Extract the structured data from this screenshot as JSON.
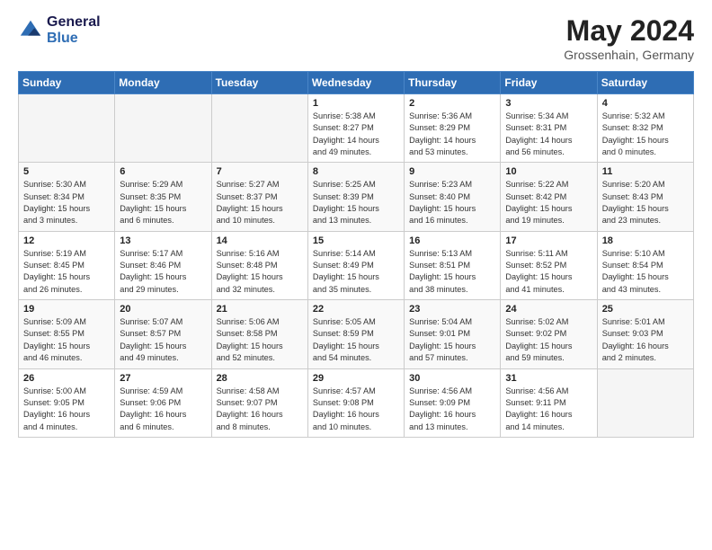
{
  "header": {
    "logo_line1": "General",
    "logo_line2": "Blue",
    "month": "May 2024",
    "location": "Grossenhain, Germany"
  },
  "weekdays": [
    "Sunday",
    "Monday",
    "Tuesday",
    "Wednesday",
    "Thursday",
    "Friday",
    "Saturday"
  ],
  "weeks": [
    [
      {
        "day": "",
        "info": ""
      },
      {
        "day": "",
        "info": ""
      },
      {
        "day": "",
        "info": ""
      },
      {
        "day": "1",
        "info": "Sunrise: 5:38 AM\nSunset: 8:27 PM\nDaylight: 14 hours\nand 49 minutes."
      },
      {
        "day": "2",
        "info": "Sunrise: 5:36 AM\nSunset: 8:29 PM\nDaylight: 14 hours\nand 53 minutes."
      },
      {
        "day": "3",
        "info": "Sunrise: 5:34 AM\nSunset: 8:31 PM\nDaylight: 14 hours\nand 56 minutes."
      },
      {
        "day": "4",
        "info": "Sunrise: 5:32 AM\nSunset: 8:32 PM\nDaylight: 15 hours\nand 0 minutes."
      }
    ],
    [
      {
        "day": "5",
        "info": "Sunrise: 5:30 AM\nSunset: 8:34 PM\nDaylight: 15 hours\nand 3 minutes."
      },
      {
        "day": "6",
        "info": "Sunrise: 5:29 AM\nSunset: 8:35 PM\nDaylight: 15 hours\nand 6 minutes."
      },
      {
        "day": "7",
        "info": "Sunrise: 5:27 AM\nSunset: 8:37 PM\nDaylight: 15 hours\nand 10 minutes."
      },
      {
        "day": "8",
        "info": "Sunrise: 5:25 AM\nSunset: 8:39 PM\nDaylight: 15 hours\nand 13 minutes."
      },
      {
        "day": "9",
        "info": "Sunrise: 5:23 AM\nSunset: 8:40 PM\nDaylight: 15 hours\nand 16 minutes."
      },
      {
        "day": "10",
        "info": "Sunrise: 5:22 AM\nSunset: 8:42 PM\nDaylight: 15 hours\nand 19 minutes."
      },
      {
        "day": "11",
        "info": "Sunrise: 5:20 AM\nSunset: 8:43 PM\nDaylight: 15 hours\nand 23 minutes."
      }
    ],
    [
      {
        "day": "12",
        "info": "Sunrise: 5:19 AM\nSunset: 8:45 PM\nDaylight: 15 hours\nand 26 minutes."
      },
      {
        "day": "13",
        "info": "Sunrise: 5:17 AM\nSunset: 8:46 PM\nDaylight: 15 hours\nand 29 minutes."
      },
      {
        "day": "14",
        "info": "Sunrise: 5:16 AM\nSunset: 8:48 PM\nDaylight: 15 hours\nand 32 minutes."
      },
      {
        "day": "15",
        "info": "Sunrise: 5:14 AM\nSunset: 8:49 PM\nDaylight: 15 hours\nand 35 minutes."
      },
      {
        "day": "16",
        "info": "Sunrise: 5:13 AM\nSunset: 8:51 PM\nDaylight: 15 hours\nand 38 minutes."
      },
      {
        "day": "17",
        "info": "Sunrise: 5:11 AM\nSunset: 8:52 PM\nDaylight: 15 hours\nand 41 minutes."
      },
      {
        "day": "18",
        "info": "Sunrise: 5:10 AM\nSunset: 8:54 PM\nDaylight: 15 hours\nand 43 minutes."
      }
    ],
    [
      {
        "day": "19",
        "info": "Sunrise: 5:09 AM\nSunset: 8:55 PM\nDaylight: 15 hours\nand 46 minutes."
      },
      {
        "day": "20",
        "info": "Sunrise: 5:07 AM\nSunset: 8:57 PM\nDaylight: 15 hours\nand 49 minutes."
      },
      {
        "day": "21",
        "info": "Sunrise: 5:06 AM\nSunset: 8:58 PM\nDaylight: 15 hours\nand 52 minutes."
      },
      {
        "day": "22",
        "info": "Sunrise: 5:05 AM\nSunset: 8:59 PM\nDaylight: 15 hours\nand 54 minutes."
      },
      {
        "day": "23",
        "info": "Sunrise: 5:04 AM\nSunset: 9:01 PM\nDaylight: 15 hours\nand 57 minutes."
      },
      {
        "day": "24",
        "info": "Sunrise: 5:02 AM\nSunset: 9:02 PM\nDaylight: 15 hours\nand 59 minutes."
      },
      {
        "day": "25",
        "info": "Sunrise: 5:01 AM\nSunset: 9:03 PM\nDaylight: 16 hours\nand 2 minutes."
      }
    ],
    [
      {
        "day": "26",
        "info": "Sunrise: 5:00 AM\nSunset: 9:05 PM\nDaylight: 16 hours\nand 4 minutes."
      },
      {
        "day": "27",
        "info": "Sunrise: 4:59 AM\nSunset: 9:06 PM\nDaylight: 16 hours\nand 6 minutes."
      },
      {
        "day": "28",
        "info": "Sunrise: 4:58 AM\nSunset: 9:07 PM\nDaylight: 16 hours\nand 8 minutes."
      },
      {
        "day": "29",
        "info": "Sunrise: 4:57 AM\nSunset: 9:08 PM\nDaylight: 16 hours\nand 10 minutes."
      },
      {
        "day": "30",
        "info": "Sunrise: 4:56 AM\nSunset: 9:09 PM\nDaylight: 16 hours\nand 13 minutes."
      },
      {
        "day": "31",
        "info": "Sunrise: 4:56 AM\nSunset: 9:11 PM\nDaylight: 16 hours\nand 14 minutes."
      },
      {
        "day": "",
        "info": ""
      }
    ]
  ]
}
